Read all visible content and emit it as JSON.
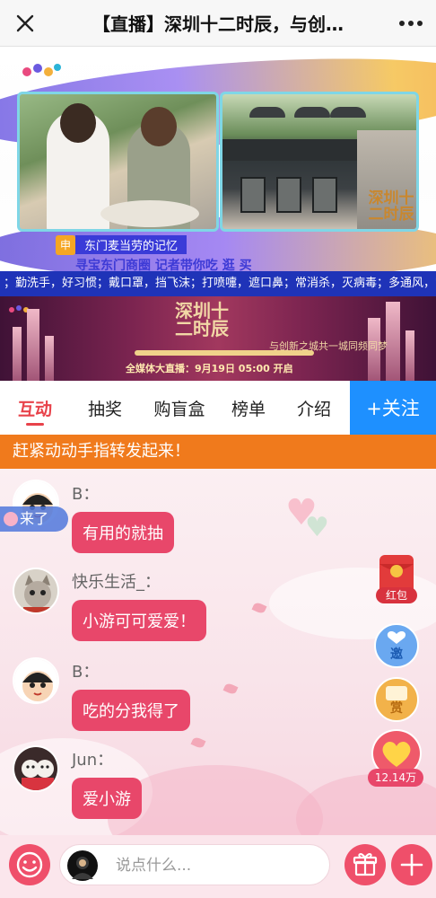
{
  "titlebar": {
    "title": "【直播】深圳十二时辰，与创…",
    "close_icon": "close-icon",
    "more_icon": "more-icon"
  },
  "video": {
    "brand_text": "深圳十二时辰",
    "caption_top": "东门麦当劳的记忆",
    "caption_main": "寻宝东门商圈  记者带你吃 逛 买",
    "caption_badge": "申"
  },
  "ticker": {
    "text": "；勤洗手，好习惯；戴口罩，挡飞沫；打喷嚏，遮口鼻；常消杀，灭病毒；多通风，空气好"
  },
  "banner": {
    "title": "深圳十二时辰",
    "date": "全媒体大直播：9月19日 05:00 开启",
    "slogan": "与创新之城共一城同频同梦"
  },
  "tabs": [
    {
      "label": "互动",
      "active": true
    },
    {
      "label": "抽奖",
      "active": false
    },
    {
      "label": "购盲盒",
      "active": false
    },
    {
      "label": "榜单",
      "active": false
    },
    {
      "label": "介绍",
      "active": false
    }
  ],
  "follow_label": "+关注",
  "announcement": "赶紧动动手指转发起来！",
  "join_notice": "来了",
  "messages": [
    {
      "name": "B：",
      "text": "有用的就抽",
      "avatar": "cartoon-boy-avatar"
    },
    {
      "name": "快乐生活_：",
      "text": "小游可可爱爱！",
      "avatar": "cat-avatar"
    },
    {
      "name": "B：",
      "text": "吃的分我得了",
      "avatar": "cartoon-boy-avatar"
    },
    {
      "name": "Jun：",
      "text": "爱小游",
      "avatar": "dolls-avatar"
    }
  ],
  "floating": {
    "redpack_label": "红包",
    "invite_label": "邀",
    "reward_label": "赏",
    "like_count": "12.14万"
  },
  "bottom": {
    "placeholder": "说点什么..."
  },
  "colors": {
    "accent_red": "#e8424a",
    "bubble": "#e8476a",
    "follow_blue": "#1e90ff",
    "announce_orange": "#f07a1c",
    "ticker_blue": "#1f33b8"
  }
}
